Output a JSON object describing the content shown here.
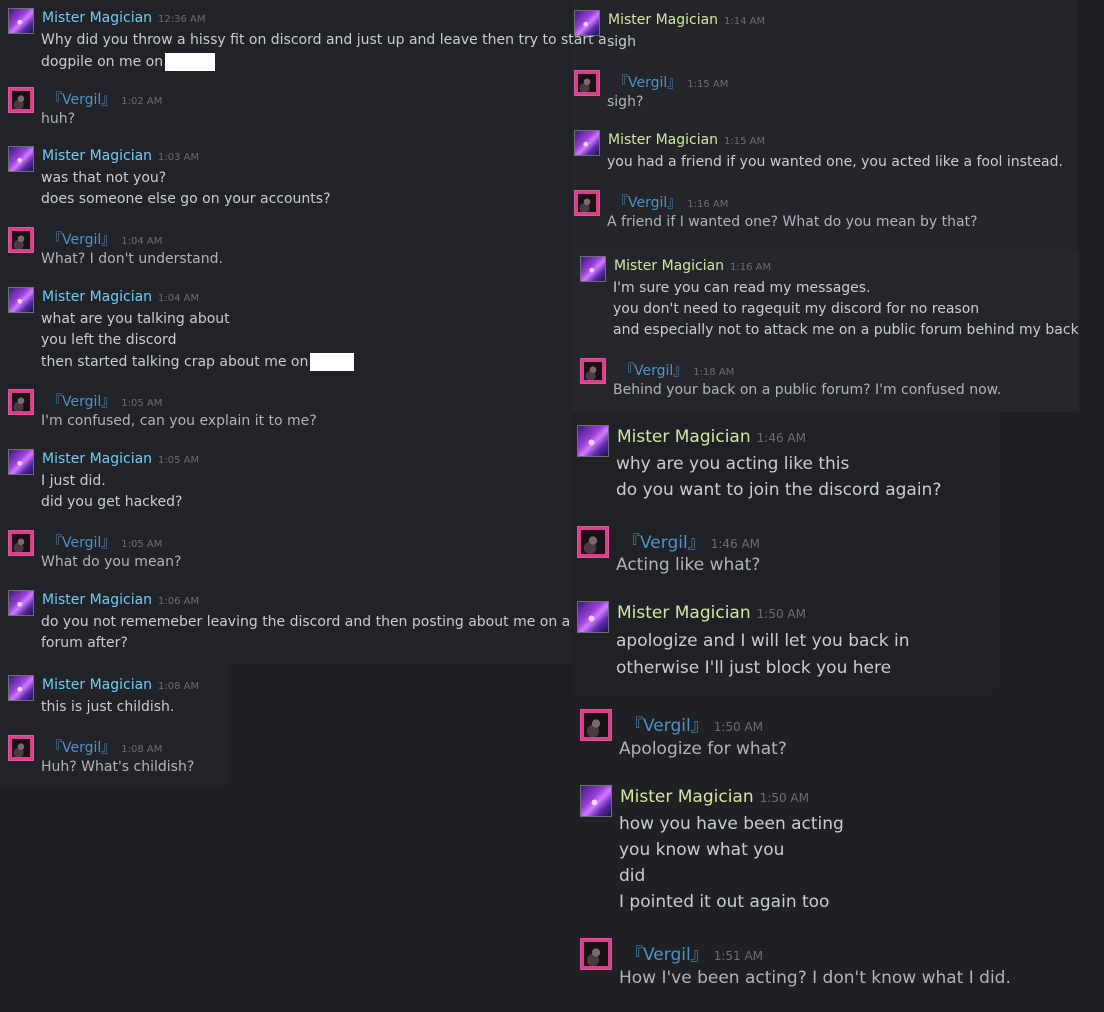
{
  "names": {
    "mister": "Mister Magician",
    "vergil": "『Vergil』"
  },
  "left": [
    {
      "time": "12:36 AM",
      "lines": [
        "Why did you throw a hissy fit on discord and just up and leave then try to start a",
        "dogpile on me on"
      ]
    },
    {
      "time": "1:02 AM",
      "lines": [
        "huh?"
      ]
    },
    {
      "time": "1:03 AM",
      "lines": [
        "was that not you?",
        "does someone else go on your accounts?"
      ]
    },
    {
      "time": "1:04 AM",
      "lines": [
        "What? I don't understand."
      ]
    },
    {
      "time": "1:04 AM",
      "lines": [
        "what are you talking about",
        "you left the discord",
        "then started talking crap about me on"
      ]
    },
    {
      "time": "1:05 AM",
      "lines": [
        "I'm confused, can you explain it to me?"
      ]
    },
    {
      "time": "1:05 AM",
      "lines": [
        "I just did.",
        "did you get hacked?"
      ]
    },
    {
      "time": "1:05 AM",
      "lines": [
        "What do you mean?"
      ]
    },
    {
      "time": "1:06 AM",
      "lines": [
        "do you not rememeber leaving the discord and then posting about me on a",
        "forum after?"
      ]
    },
    {
      "time": "1:08 AM",
      "lines": [
        "this is just childish."
      ]
    },
    {
      "time": "1:08 AM",
      "lines": [
        "Huh? What's childish?"
      ]
    }
  ],
  "right": [
    {
      "time": "1:14 AM",
      "lines": [
        "sigh"
      ]
    },
    {
      "time": "1:15 AM",
      "lines": [
        "sigh?"
      ]
    },
    {
      "time": "1:15 AM",
      "lines": [
        "you had a friend if you wanted one, you acted like a fool instead."
      ]
    },
    {
      "time": "1:16 AM",
      "lines": [
        "A friend if I wanted one? What do you mean by that?"
      ]
    },
    {
      "time": "1:16 AM",
      "lines": [
        "I'm sure you can read my messages.",
        "you don't need to ragequit my discord for no reason",
        "and especially not to attack me on a public forum behind my back"
      ]
    },
    {
      "time": "1:18 AM",
      "lines": [
        "Behind your back on a public forum? I'm confused now."
      ]
    },
    {
      "time": "1:46 AM",
      "lines": [
        "why are you acting like this",
        "do you want to join the discord again?"
      ]
    },
    {
      "time": "1:46 AM",
      "lines": [
        "Acting like what?"
      ]
    },
    {
      "time": "1:50 AM",
      "lines": [
        "apologize and I will let you back in",
        "otherwise I'll just block you here"
      ]
    },
    {
      "time": "1:50 AM",
      "lines": [
        "Apologize for what?"
      ]
    },
    {
      "time": "1:50 AM",
      "lines": [
        "how you have been acting",
        "you know what you",
        "did",
        "I pointed it out again too"
      ]
    },
    {
      "time": "1:51 AM",
      "lines": [
        "How I've been acting? I don't know what I did."
      ]
    }
  ]
}
